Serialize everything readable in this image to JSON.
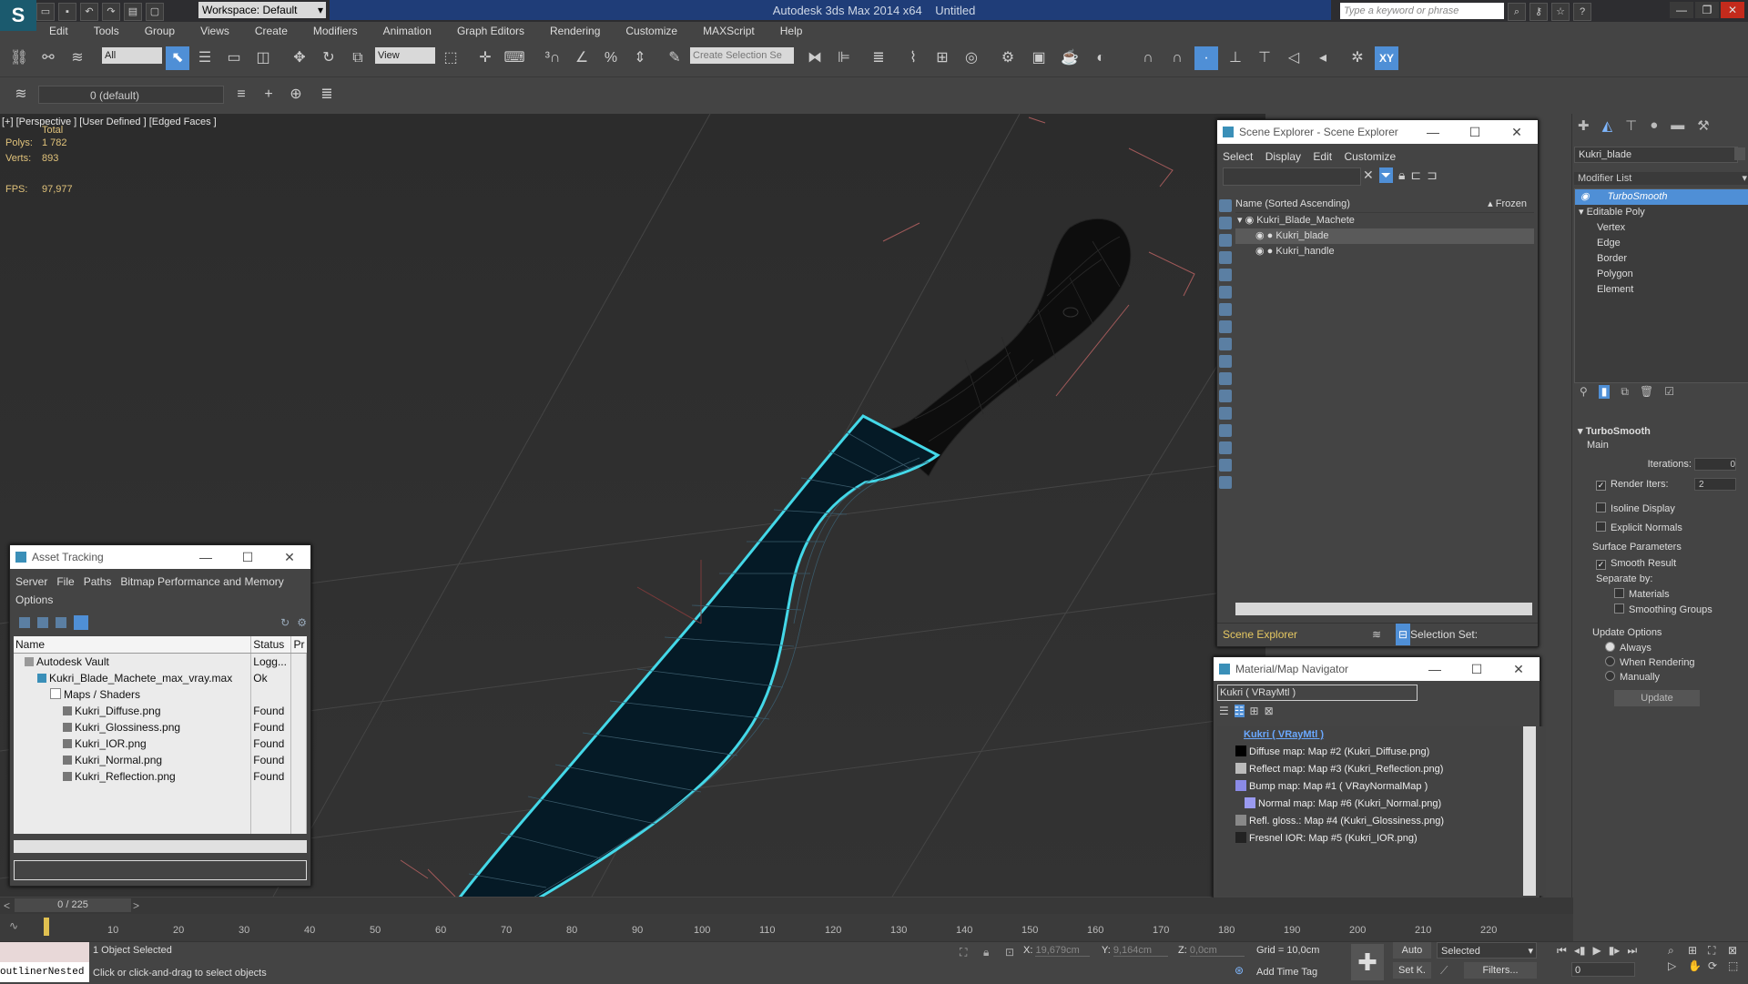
{
  "app": {
    "title": "Autodesk 3ds Max  2014 x64",
    "document": "Untitled",
    "workspace": "Workspace: Default",
    "search_placeholder": "Type a keyword or phrase",
    "accent": "#4f8fd6",
    "selection_color": "#44d8e8"
  },
  "menubar": [
    "Edit",
    "Tools",
    "Group",
    "Views",
    "Create",
    "Modifiers",
    "Animation",
    "Graph Editors",
    "Rendering",
    "Customize",
    "MAXScript",
    "Help"
  ],
  "toolbar": {
    "selection_filter": "All",
    "ref_coord": "View",
    "named_selection_placeholder": "Create Selection Se",
    "axis_constraint": "XY",
    "layer": "0 (default)"
  },
  "viewport": {
    "label": "[+] [Perspective ]  [User Defined ] [Edged Faces ]",
    "stats_total": "Total",
    "polys_label": "Polys:",
    "polys_value": "1 782",
    "verts_label": "Verts:",
    "verts_value": "893",
    "fps_label": "FPS:",
    "fps_value": "97,977"
  },
  "scene_explorer": {
    "title": "Scene Explorer - Scene Explorer",
    "menu": [
      "Select",
      "Display",
      "Edit",
      "Customize"
    ],
    "col_name": "Name (Sorted Ascending)",
    "col_frozen": "▴ Frozen",
    "rows": [
      {
        "name": "Kukri_Blade_Machete",
        "indent": 0,
        "selected": false
      },
      {
        "name": "Kukri_blade",
        "indent": 1,
        "selected": true
      },
      {
        "name": "Kukri_handle",
        "indent": 1,
        "selected": false
      }
    ],
    "footer_tab": "Scene Explorer",
    "selection_set_label": "Selection Set:"
  },
  "asset_tracking": {
    "title": "Asset Tracking",
    "menu": [
      "Server",
      "File",
      "Paths",
      "Bitmap Performance and Memory",
      "Options"
    ],
    "columns": [
      "Name",
      "Status",
      "Pr"
    ],
    "rows": [
      {
        "name": "Autodesk Vault",
        "status": "Logg...",
        "indent": 0
      },
      {
        "name": "Kukri_Blade_Machete_max_vray.max",
        "status": "Ok",
        "indent": 1
      },
      {
        "name": "Maps / Shaders",
        "status": "",
        "indent": 2
      },
      {
        "name": "Kukri_Diffuse.png",
        "status": "Found",
        "indent": 3
      },
      {
        "name": "Kukri_Glossiness.png",
        "status": "Found",
        "indent": 3
      },
      {
        "name": "Kukri_IOR.png",
        "status": "Found",
        "indent": 3
      },
      {
        "name": "Kukri_Normal.png",
        "status": "Found",
        "indent": 3
      },
      {
        "name": "Kukri_Reflection.png",
        "status": "Found",
        "indent": 3
      }
    ]
  },
  "material_navigator": {
    "title": "Material/Map Navigator",
    "current": "Kukri  ( VRayMtl )",
    "root": "Kukri  ( VRayMtl )",
    "maps": [
      "Diffuse map: Map #2 (Kukri_Diffuse.png)",
      "Reflect map: Map #3 (Kukri_Reflection.png)",
      "Bump map: Map #1  ( VRayNormalMap )",
      "Normal map: Map #6 (Kukri_Normal.png)",
      "Refl. gloss.: Map #4 (Kukri_Glossiness.png)",
      "Fresnel IOR: Map #5 (Kukri_IOR.png)"
    ]
  },
  "command_panel": {
    "object_name": "Kukri_blade",
    "modifier_list": "Modifier List",
    "stack": [
      "TurboSmooth",
      "Editable Poly",
      "Vertex",
      "Edge",
      "Border",
      "Polygon",
      "Element"
    ],
    "rollout_title": "TurboSmooth",
    "main_label": "Main",
    "iterations_label": "Iterations:",
    "iterations_value": "0",
    "render_iters_label": "Render Iters:",
    "render_iters_value": "2",
    "isoline": "Isoline Display",
    "explicit_normals": "Explicit Normals",
    "surface_params": "Surface Parameters",
    "smooth_result": "Smooth Result",
    "separate_by": "Separate by:",
    "materials": "Materials",
    "smoothing_groups": "Smoothing Groups",
    "update_options": "Update Options",
    "always": "Always",
    "when_rendering": "When Rendering",
    "manually": "Manually",
    "update_button": "Update"
  },
  "timeline": {
    "frame": "0 / 225",
    "ticks": [
      "10",
      "20",
      "30",
      "40",
      "50",
      "60",
      "70",
      "80",
      "90",
      "100",
      "110",
      "120",
      "130",
      "140",
      "150",
      "160",
      "170",
      "180",
      "190",
      "200",
      "210",
      "220"
    ]
  },
  "status": {
    "script_field": "outlinerNested",
    "selected": "1 Object Selected",
    "prompt": "Click or click-and-drag to select objects",
    "x_label": "X:",
    "x_value": "19,679cm",
    "y_label": "Y:",
    "y_value": "9,164cm",
    "z_label": "Z:",
    "z_value": "0,0cm",
    "grid": "Grid = 10,0cm",
    "add_time_tag": "Add Time Tag",
    "auto_key": "Auto",
    "set_key": "Set K.",
    "key_mode": "Selected",
    "filters": "Filters...",
    "current_frame": "0"
  }
}
